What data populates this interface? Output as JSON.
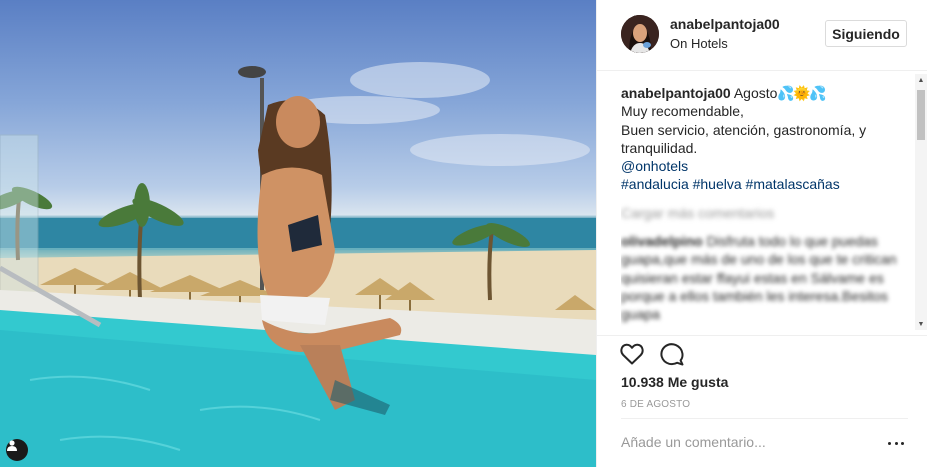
{
  "post": {
    "photo_alt": "Woman sitting at the edge of an infinity pool overlooking a beach",
    "tag_icon": "user-tag-icon"
  },
  "header": {
    "username": "anabelpantoja00",
    "location": "On Hotels",
    "follow_label": "Siguiendo"
  },
  "caption": {
    "username": "anabelpantoja00",
    "lines": [
      "Agosto",
      "Muy recomendable,",
      "Buen servicio, atención, gastronomía, y",
      "tranquilidad.",
      "@onhotels",
      "#andalucia #huelva #matalascañas"
    ],
    "emojis": [
      "💦",
      "🌞",
      "💦"
    ]
  },
  "comments": {
    "load_more": "Cargar más comentarios",
    "items": [
      {
        "user": "olivadelpino",
        "text": "Disfruta todo lo que puedas guapa,que más de uno de los que te critican quisieran estar ffayui estas en Sálvame es porque a ellos también les interesa.Besitos guapa"
      }
    ]
  },
  "actions": {
    "like_icon": "heart-icon",
    "comment_icon": "comment-icon"
  },
  "likes": "10.938 Me gusta",
  "date": "6 DE AGOSTO",
  "comment_box": {
    "placeholder": "Añade un comentario...",
    "more_icon": "more-options-icon"
  },
  "colors": {
    "text": "#262626",
    "muted": "#999999",
    "link": "#003569",
    "border": "#efefef"
  }
}
